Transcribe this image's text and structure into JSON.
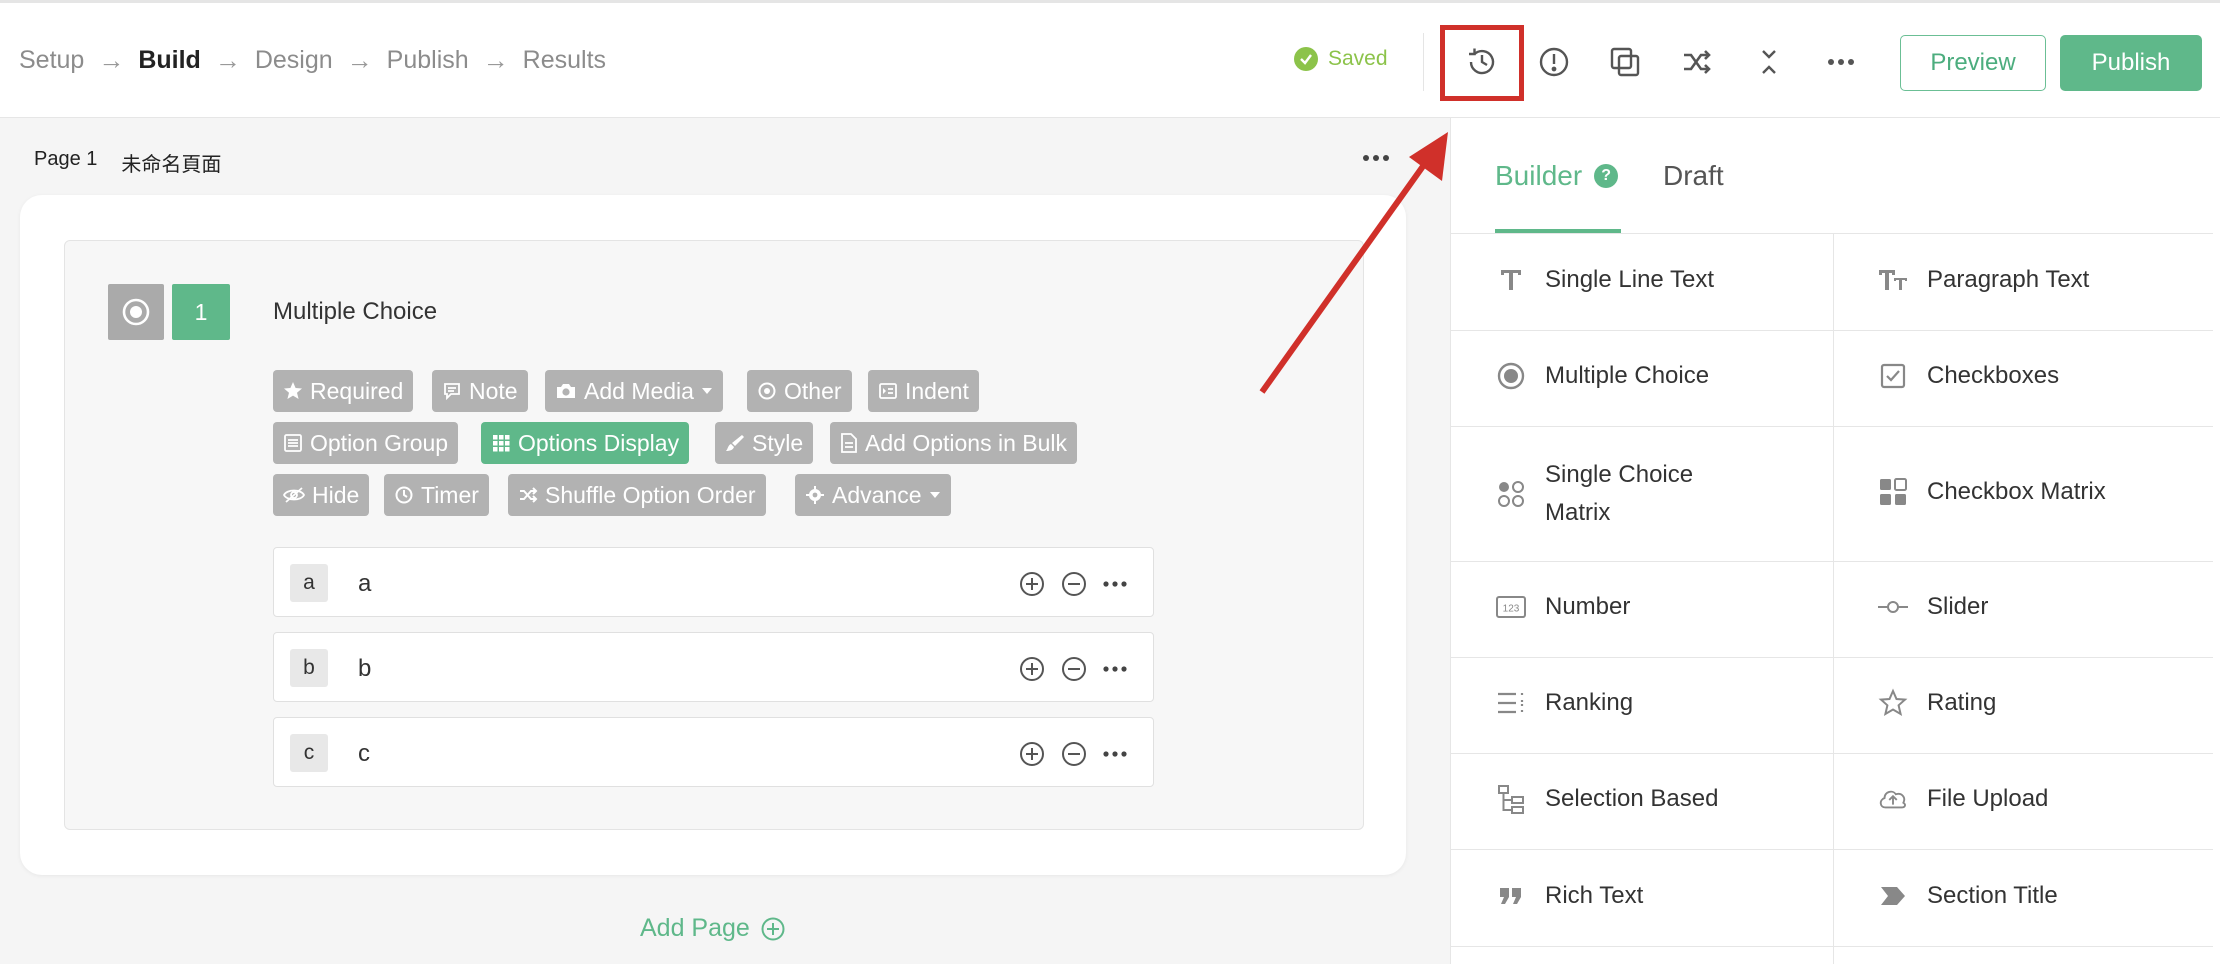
{
  "steps": [
    "Setup",
    "Build",
    "Design",
    "Publish",
    "Results"
  ],
  "active_step": "Build",
  "status": {
    "saved_label": "Saved"
  },
  "toolbar": {
    "icons": [
      "history-icon",
      "alert-icon",
      "duplicate-icon",
      "shuffle-icon",
      "collapse-icon",
      "more-icon"
    ],
    "preview_label": "Preview",
    "publish_label": "Publish"
  },
  "page": {
    "number_label": "Page 1",
    "name": "未命名頁面"
  },
  "question": {
    "number": "1",
    "title": "Multiple Choice",
    "tags": {
      "required": "Required",
      "note": "Note",
      "add_media": "Add Media",
      "other": "Other",
      "indent": "Indent",
      "option_group": "Option Group",
      "options_display": "Options Display",
      "style": "Style",
      "add_options_bulk": "Add Options in Bulk",
      "hide": "Hide",
      "timer": "Timer",
      "shuffle": "Shuffle Option Order",
      "advance": "Advance"
    },
    "options": [
      {
        "letter": "a",
        "text": "a"
      },
      {
        "letter": "b",
        "text": "b"
      },
      {
        "letter": "c",
        "text": "c"
      }
    ]
  },
  "add_page_label": "Add Page",
  "panel": {
    "tabs": {
      "builder": "Builder",
      "draft": "Draft"
    },
    "items": {
      "single_line_text": "Single Line Text",
      "paragraph_text": "Paragraph Text",
      "multiple_choice": "Multiple Choice",
      "checkboxes": "Checkboxes",
      "single_choice_matrix_1": "Single Choice",
      "single_choice_matrix_2": "Matrix",
      "checkbox_matrix": "Checkbox Matrix",
      "number": "Number",
      "slider": "Slider",
      "ranking": "Ranking",
      "rating": "Rating",
      "selection_based": "Selection Based",
      "file_upload": "File Upload",
      "rich_text": "Rich Text",
      "section_title": "Section Title"
    },
    "number_icon_text": "123"
  },
  "colors": {
    "accent": "#5fb88a",
    "saved": "#8cc34a",
    "highlight": "#d0302a",
    "tag_gray": "#b2b2b2"
  }
}
